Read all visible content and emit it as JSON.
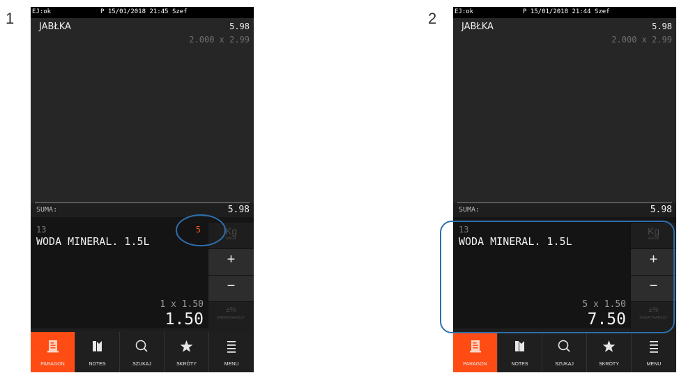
{
  "panels": [
    {
      "number": "1",
      "status": {
        "ej": "EJ:ok",
        "datetime": "P 15/01/2018 21:45 Szef"
      },
      "receipt": {
        "item_name": "JABŁKA",
        "item_total": "5.98",
        "item_detail": "2.000 x 2.99"
      },
      "suma": {
        "label": "SUMA:",
        "value": "5.98"
      },
      "entry": {
        "code": "13",
        "qty": "5",
        "name": "WODA MINERAL. 1.5L",
        "calc": "1 x 1.50",
        "amount": "1.50"
      },
      "keys": {
        "kg": "Kg",
        "waga": "WAGA",
        "plus": "+",
        "minus": "−",
        "percent": "±%",
        "rabat": "RABAT/NARZUT"
      },
      "tabs": [
        "PARAGON",
        "NOTES",
        "SZUKAJ",
        "SKRÓTY",
        "MENU"
      ],
      "highlight": "qty-circle"
    },
    {
      "number": "2",
      "status": {
        "ej": "EJ:ok",
        "datetime": "P 15/01/2018 21:44 Szef"
      },
      "receipt": {
        "item_name": "JABŁKA",
        "item_total": "5.98",
        "item_detail": "2.000 x 2.99"
      },
      "suma": {
        "label": "SUMA:",
        "value": "5.98"
      },
      "entry": {
        "code": "13",
        "qty": "",
        "name": "WODA MINERAL. 1.5L",
        "calc": "5 x 1.50",
        "amount": "7.50"
      },
      "keys": {
        "kg": "Kg",
        "waga": "WAGA",
        "plus": "+",
        "minus": "−",
        "percent": "±%",
        "rabat": "RABAT/NARZUT"
      },
      "tabs": [
        "PARAGON",
        "NOTES",
        "SZUKAJ",
        "SKRÓTY",
        "MENU"
      ],
      "highlight": "entry-rounded-rect"
    }
  ],
  "colors": {
    "accent": "#ff4c14",
    "highlight_stroke": "#2e6fae",
    "qty_red": "#ff5a1e"
  },
  "icons": [
    "receipt-icon",
    "notes-icon",
    "search-icon",
    "star-icon",
    "menu-icon"
  ]
}
